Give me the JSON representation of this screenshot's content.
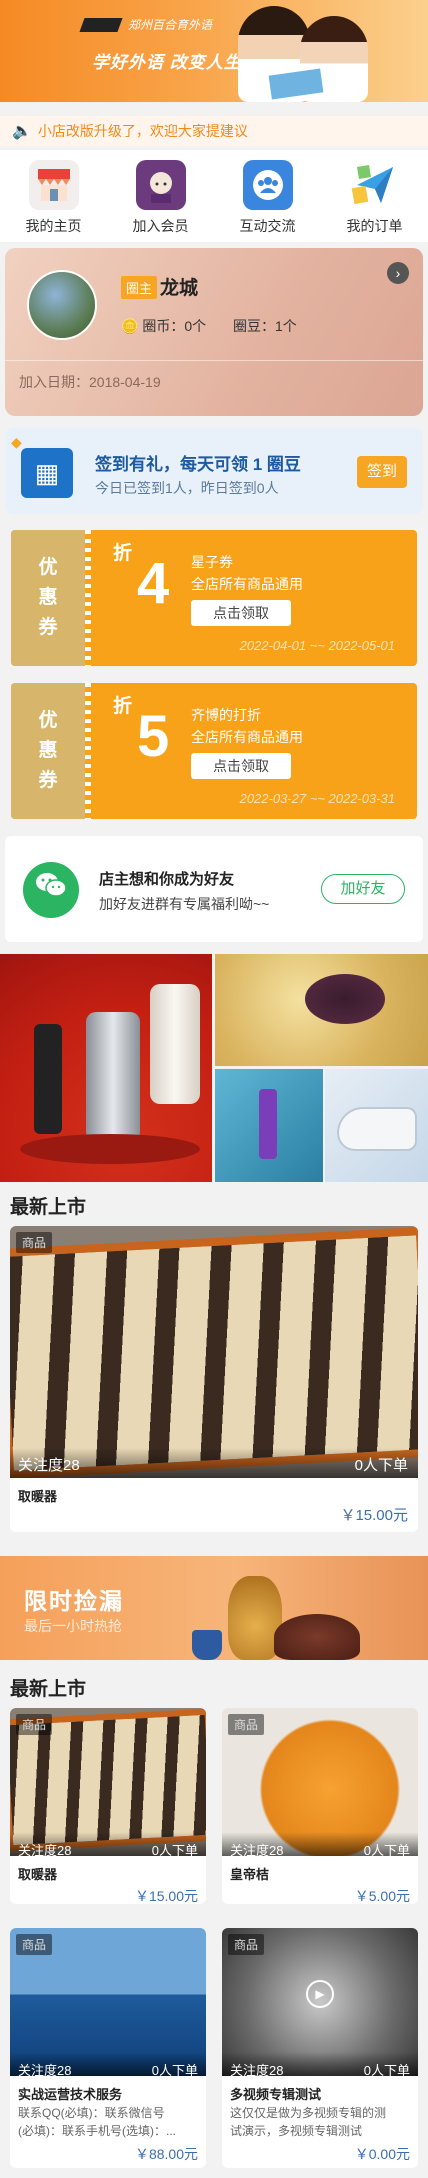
{
  "banner": {
    "school": "郑州百合育外语",
    "slogan": "学好外语 改变人生"
  },
  "notice": {
    "text": "小店改版升级了，欢迎大家提建议"
  },
  "nav": {
    "items": [
      {
        "label": "我的主页",
        "icon": "shop-icon",
        "color": "#e8423a"
      },
      {
        "label": "加入会员",
        "icon": "member-icon",
        "color": "#7a3e8e"
      },
      {
        "label": "互动交流",
        "icon": "group-chat-icon",
        "color": "#2f78d6"
      },
      {
        "label": "我的订单",
        "icon": "paper-plane-icon",
        "color": "#3aa0e6"
      }
    ]
  },
  "member": {
    "role": "圈主",
    "name": "龙城",
    "coin": "圈币：0个",
    "bean": "圈豆：1个",
    "join_date": "加入日期：2018-04-19"
  },
  "signin": {
    "title": "签到有礼，每天可领 1 圈豆",
    "stat": "今日已签到1人，昨日签到0人",
    "button": "签到"
  },
  "coupons": [
    {
      "left": [
        "优",
        "惠",
        "券"
      ],
      "zhe": "折",
      "value": "4",
      "title": "星子券",
      "desc": "全店所有商品通用",
      "button": "点击领取",
      "date": "2022-04-01 ~~ 2022-05-01"
    },
    {
      "left": [
        "优",
        "惠",
        "券"
      ],
      "zhe": "折",
      "value": "5",
      "title": "齐博的打折",
      "desc": "全店所有商品通用",
      "button": "点击领取",
      "date": "2022-03-27 ~~ 2022-03-31"
    }
  ],
  "friend": {
    "title": "店主想和你成为好友",
    "desc": "加好友进群有专属福利呦~~",
    "button": "加好友"
  },
  "sections": {
    "new1": "最新上市",
    "new2": "最新上市"
  },
  "featured": {
    "tag": "商品",
    "attention": "关注度28",
    "orders": "0人下单",
    "name": "取暖器",
    "price": "￥15.00元"
  },
  "promo": {
    "title": "限时捡漏",
    "subtitle": "最后一小时热抢"
  },
  "products": [
    {
      "tag": "商品",
      "attention": "关注度28",
      "orders": "0人下单",
      "name": "取暖器",
      "desc": [],
      "price": "￥15.00元",
      "img": "heater"
    },
    {
      "tag": "商品",
      "attention": "关注度28",
      "orders": "0人下单",
      "name": "皇帝桔",
      "desc": [],
      "price": "￥5.00元",
      "img": "orange"
    },
    {
      "tag": "商品",
      "attention": "关注度28",
      "orders": "0人下单",
      "name": "实战运营技术服务",
      "desc": [
        "联系QQ(必填)：联系微信号",
        "(必填)：联系手机号(选填)：..."
      ],
      "price": "￥88.00元",
      "img": "sea"
    },
    {
      "tag": "商品",
      "attention": "关注度28",
      "orders": "0人下单",
      "name": "多视频专辑测试",
      "desc": [
        "这仅仅是做为多视频专辑的测",
        "试演示，多视频专辑测试"
      ],
      "price": "￥0.00元",
      "img": "video"
    }
  ]
}
